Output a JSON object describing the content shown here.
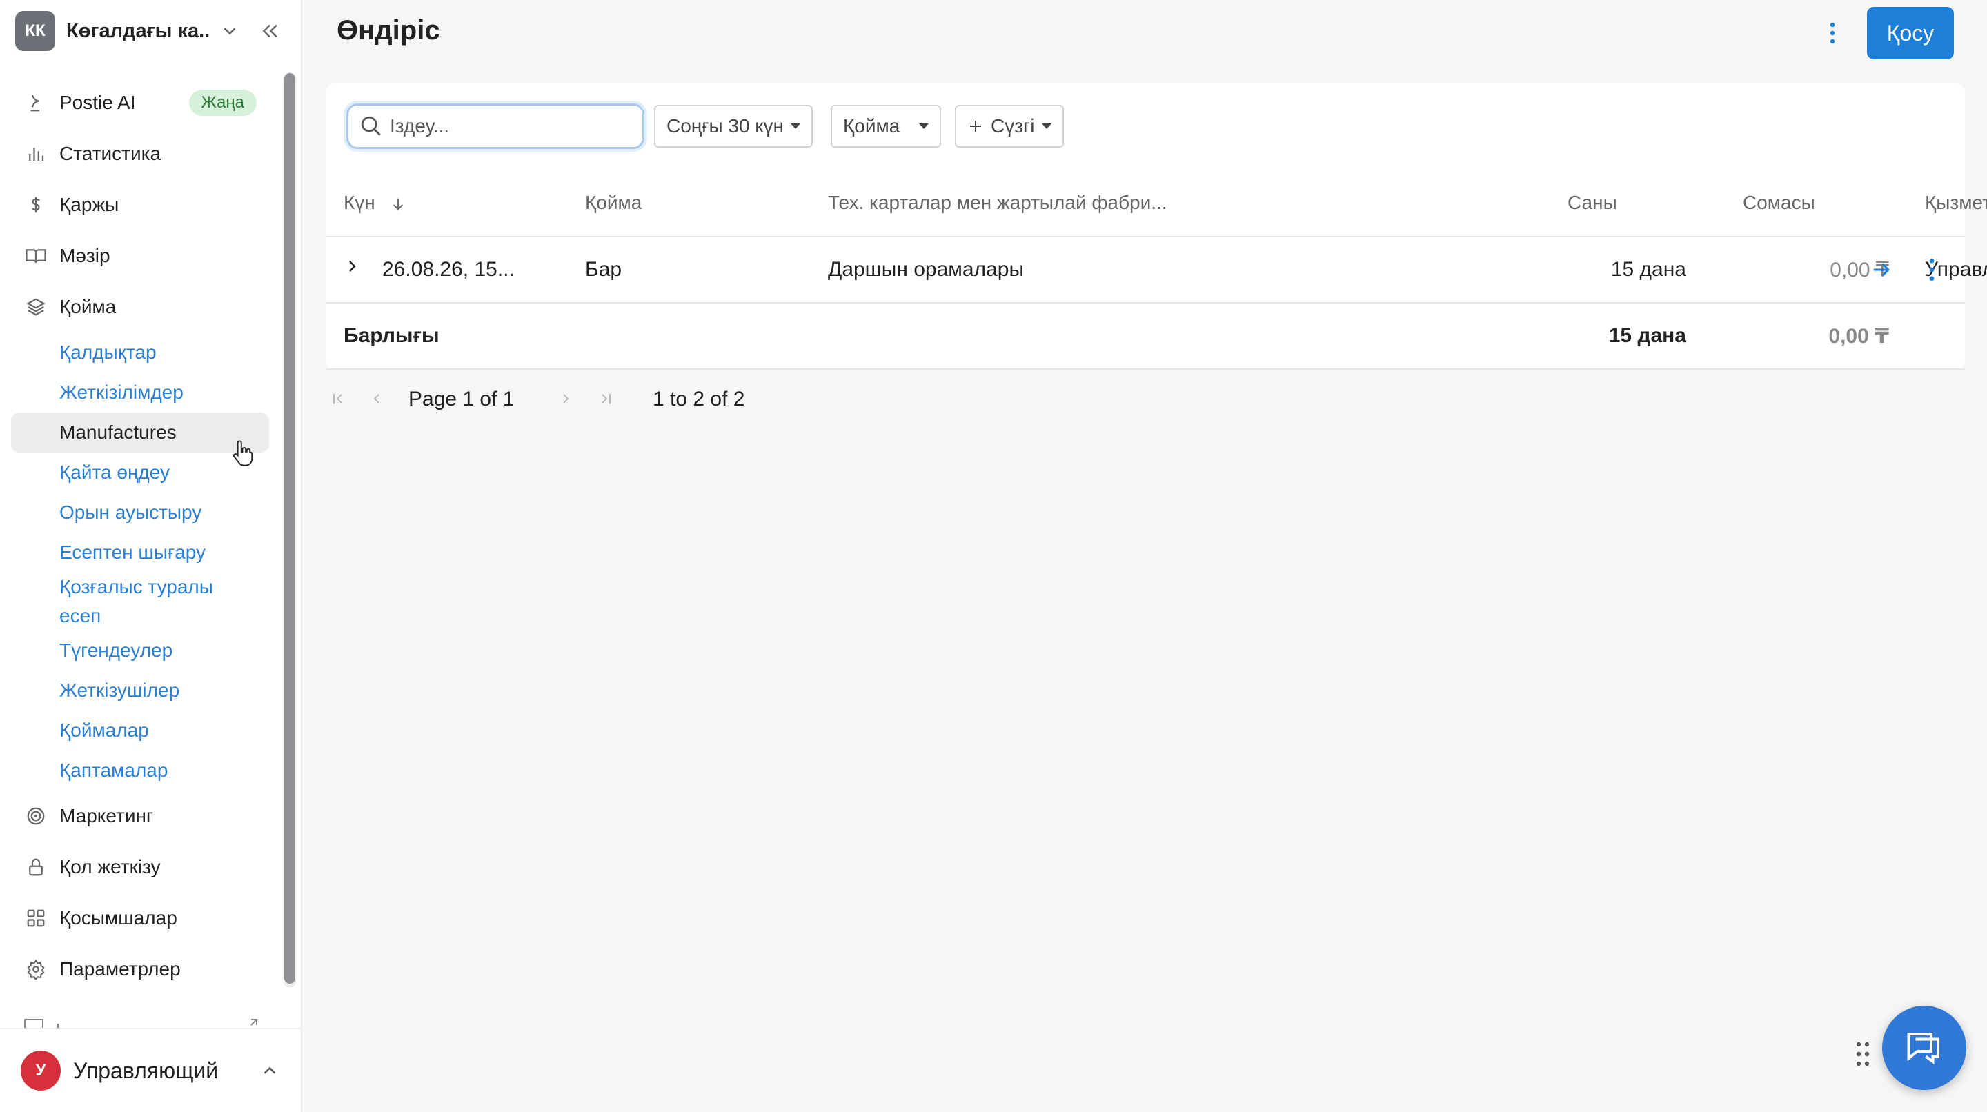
{
  "workspace": {
    "initials": "КК",
    "name": "Көгалдағы ка..."
  },
  "nav": {
    "postie": {
      "label": "Postie AI",
      "badge": "Жаңа"
    },
    "stats": "Статистика",
    "finance": "Қаржы",
    "menu": "Мәзір",
    "warehouse": "Қойма",
    "warehouse_items": [
      "Қалдықтар",
      "Жеткізілімдер",
      "Manufactures",
      "Қайта өңдеу",
      "Орын ауыстыру",
      "Есептен шығару",
      "Қозғалыс туралы есеп",
      "Түгендеулер",
      "Жеткізушілер",
      "Қоймалар",
      "Қаптамалар"
    ],
    "marketing": "Маркетинг",
    "access": "Қол жеткізу",
    "apps": "Қосымшалар",
    "settings": "Параметрлер"
  },
  "user": {
    "initial": "У",
    "name": "Управляющий"
  },
  "page": {
    "title": "Өндіріс",
    "add_label": "Қосу"
  },
  "filters": {
    "search_placeholder": "Іздеу...",
    "period": "Соңғы 30 күн",
    "warehouse": "Қойма",
    "add_filter": "Сүзгі"
  },
  "table": {
    "columns": [
      "Күн",
      "Қойма",
      "Тех. карталар мен жартылай фабри...",
      "Саны",
      "Сомасы",
      "Қызметкер"
    ],
    "rows": [
      {
        "date": "26.08.26, 15...",
        "warehouse": "Бар",
        "item": "Даршын орамалары",
        "qty": "15 дана",
        "sum": "0,00 ₸",
        "employee": "Управляющий"
      }
    ],
    "total": {
      "label": "Барлығы",
      "qty": "15 дана",
      "sum": "0,00 ₸"
    }
  },
  "pager": {
    "page_text": "Page 1 of 1",
    "range_text": "1 to 2 of 2"
  },
  "colors": {
    "accent": "#1e7fd8",
    "link": "#2a7fd4",
    "badge_bg": "#d6f1d9"
  }
}
